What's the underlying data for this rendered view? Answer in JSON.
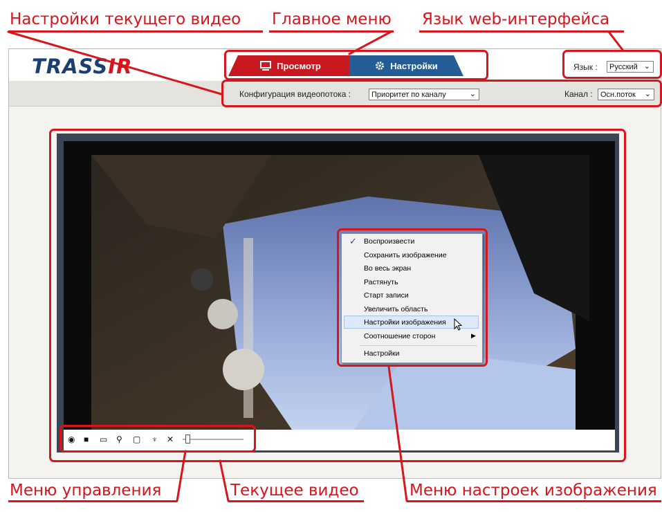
{
  "annotations": {
    "current_video_settings": "Настройки текущего видео",
    "main_menu": "Главное меню",
    "web_language": "Язык web-интерфейса",
    "control_menu": "Меню управления",
    "current_video": "Текущее видео",
    "image_settings_menu": "Меню настроек изображения",
    "color": "#d8141c"
  },
  "header": {
    "logo_a": "TRASS",
    "logo_b": "IR",
    "tabs": [
      {
        "label": "Просмотр",
        "icon": "monitor-icon",
        "active": true
      },
      {
        "label": "Настройки",
        "icon": "gear-icon",
        "active": false
      }
    ],
    "language_label": "Язык :",
    "language_value": "Русский"
  },
  "subbar": {
    "stream_config_label": "Конфигурация видеопотока :",
    "stream_config_value": "Приоритет по каналу",
    "channel_label": "Канал :",
    "channel_value": "Осн.поток"
  },
  "controls": [
    {
      "icon": "pause-icon",
      "glyph": "◉"
    },
    {
      "icon": "camera-snapshot-icon",
      "glyph": "■"
    },
    {
      "icon": "fullscreen-icon",
      "glyph": "▭"
    },
    {
      "icon": "zoom-icon",
      "glyph": "⚲"
    },
    {
      "icon": "record-icon",
      "glyph": "▢"
    },
    {
      "icon": "microphone-icon",
      "glyph": "♆"
    },
    {
      "icon": "speaker-mute-icon",
      "glyph": "✕"
    }
  ],
  "volume_level": 0.05,
  "context_menu": {
    "items": [
      {
        "label": "Воспроизвести",
        "checked": true
      },
      {
        "label": "Сохранить изображение"
      },
      {
        "label": "Во весь экран"
      },
      {
        "label": "Растянуть"
      },
      {
        "label": "Старт записи"
      },
      {
        "label": "Увеличить область"
      },
      {
        "label": "Настройки изображения",
        "highlighted": true
      },
      {
        "label": "Соотношение сторон",
        "submenu": true
      },
      {
        "label": "Настройки"
      }
    ]
  },
  "colors": {
    "accent_red": "#c81820",
    "accent_blue": "#245c96"
  }
}
